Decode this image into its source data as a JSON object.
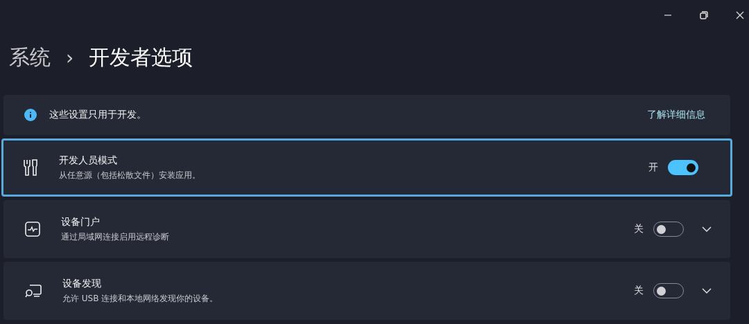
{
  "breadcrumb": {
    "parent": "系统",
    "separator": "›",
    "current": "开发者选项"
  },
  "info_bar": {
    "text": "这些设置只用于开发。",
    "link": "了解详细信息"
  },
  "settings": [
    {
      "title": "开发人员模式",
      "description": "从任意源（包括松散文件）安装应用。",
      "state_label": "开",
      "on": true,
      "selected": true,
      "expandable": false
    },
    {
      "title": "设备门户",
      "description": "通过局域网连接启用远程诊断",
      "state_label": "关",
      "on": false,
      "selected": false,
      "expandable": true
    },
    {
      "title": "设备发现",
      "description": "允许 USB 连接和本地网络发现你的设备。",
      "state_label": "关",
      "on": false,
      "selected": false,
      "expandable": true
    }
  ]
}
